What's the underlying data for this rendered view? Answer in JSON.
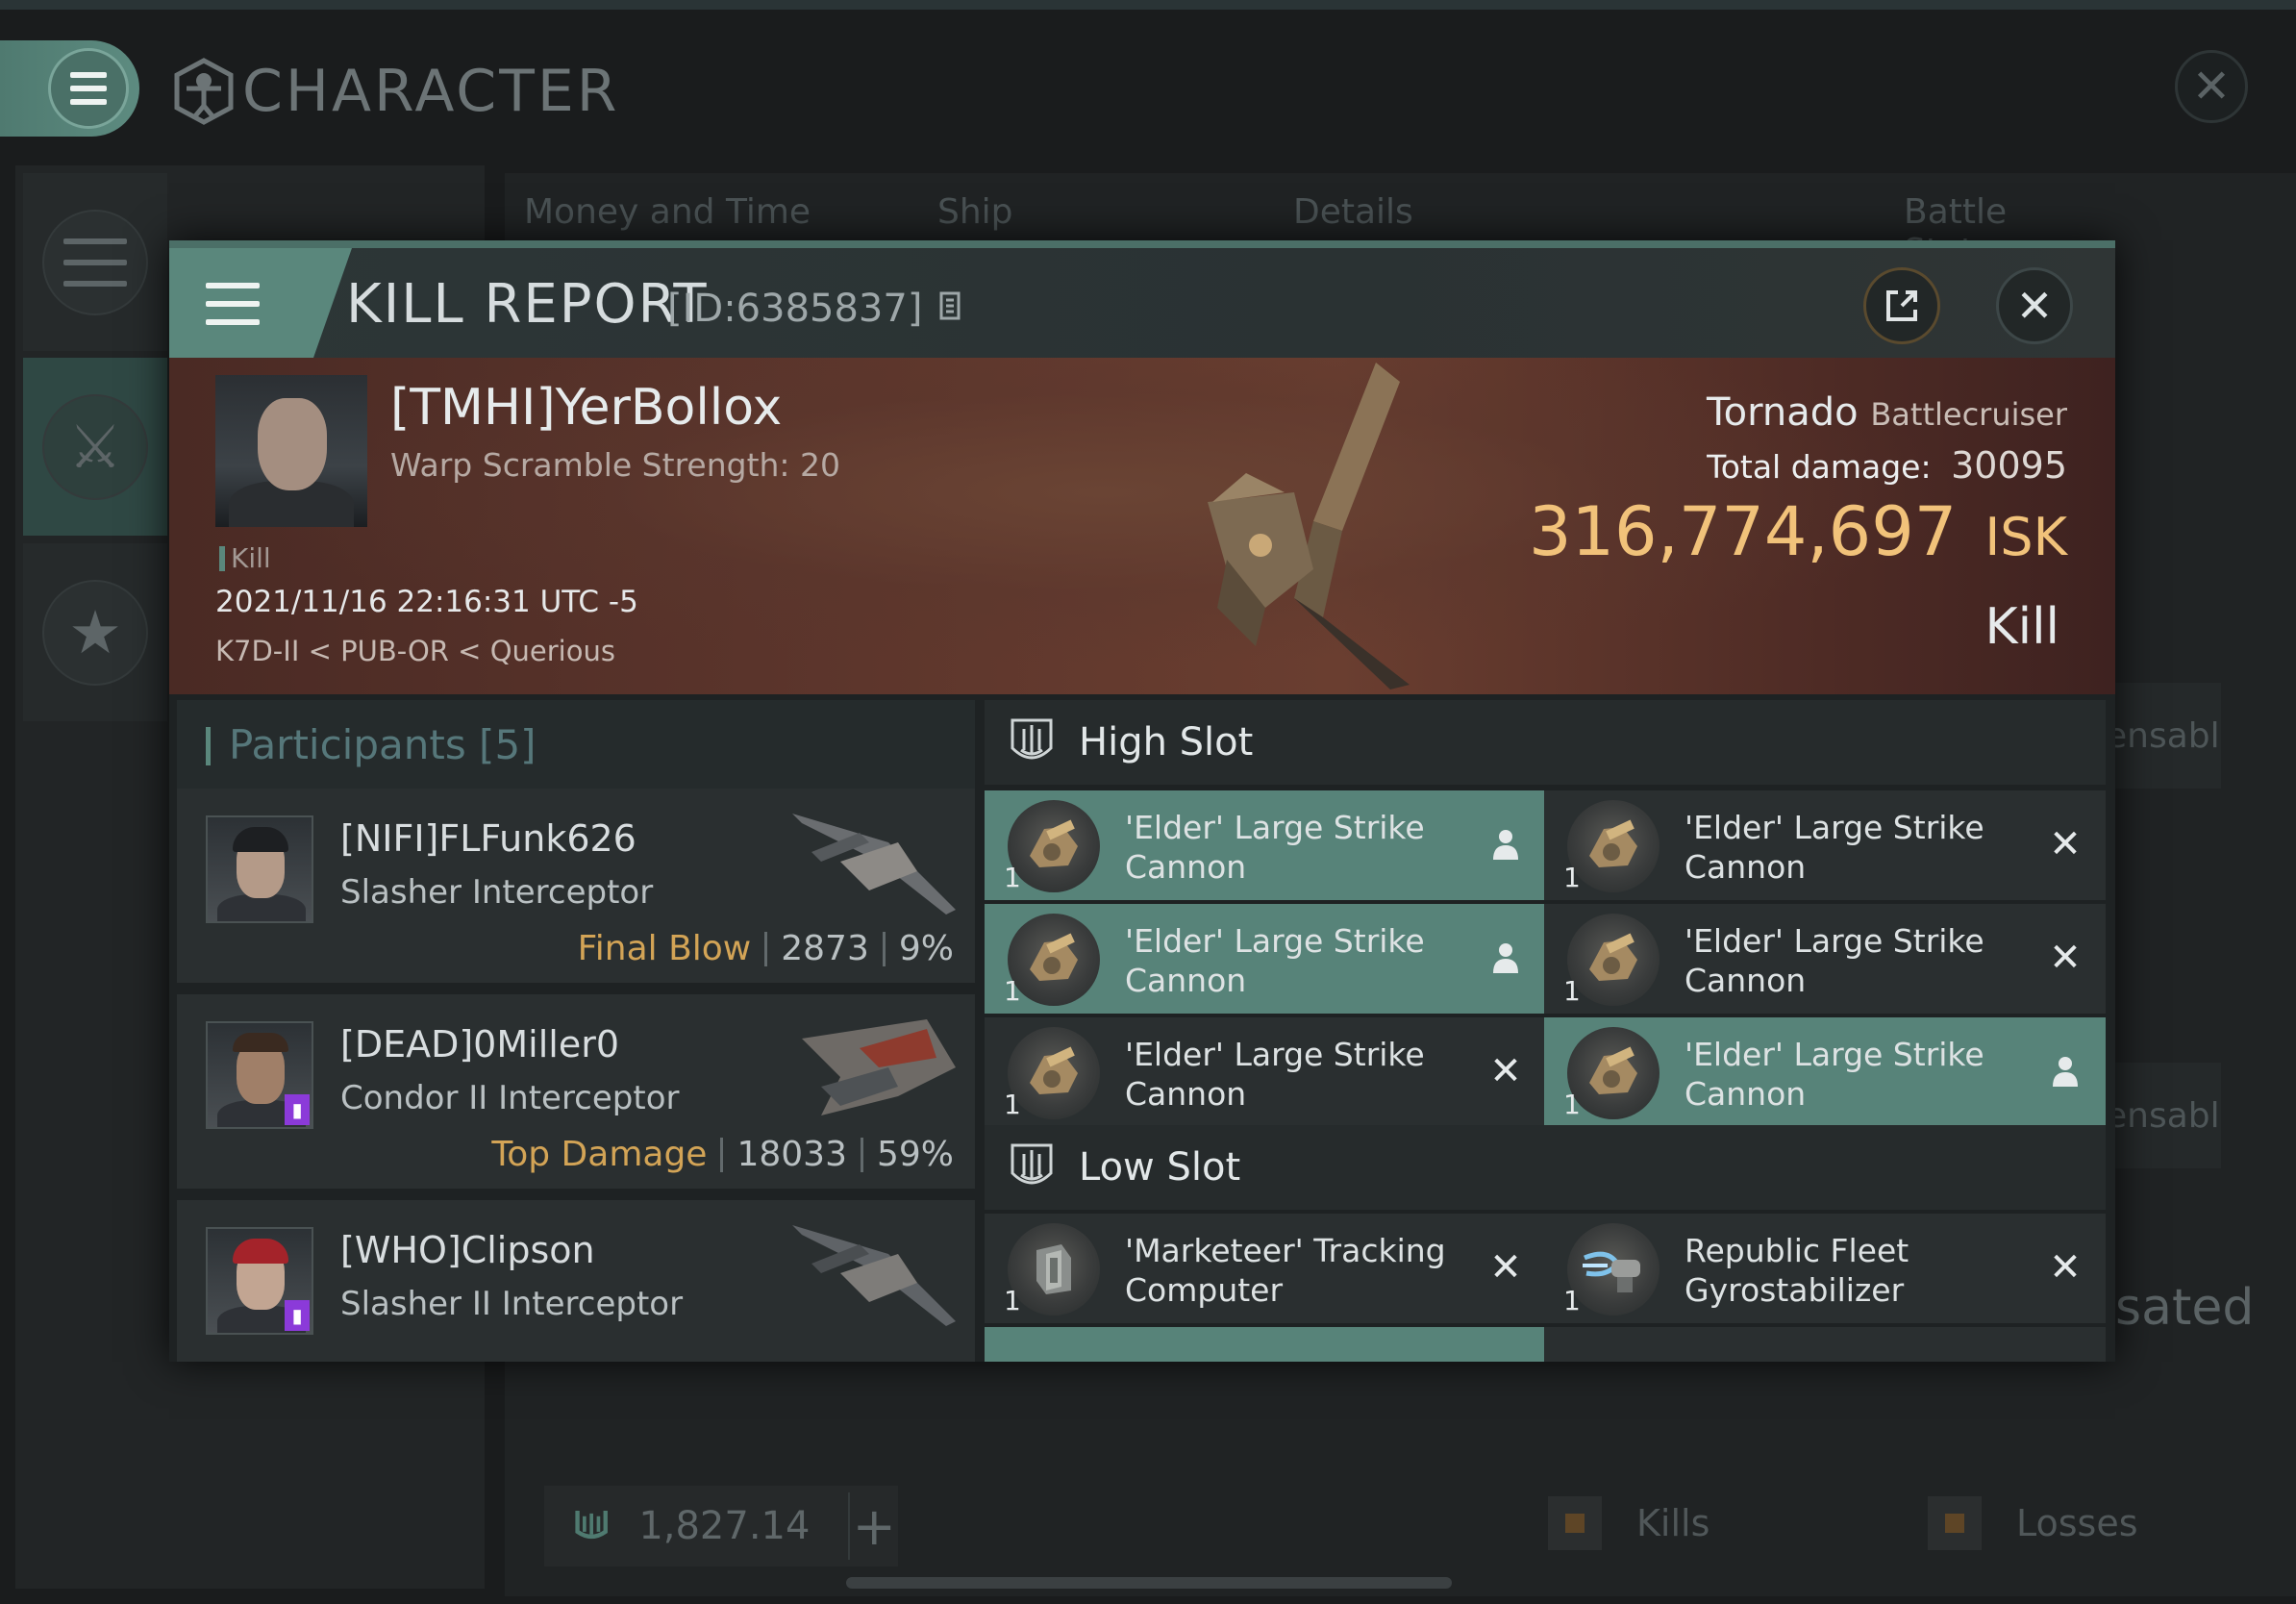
{
  "background_window": {
    "title": "CHARACTER",
    "tabs": [
      "Money and Time",
      "Ship",
      "Details",
      "Battle Status"
    ],
    "right_buttons": [
      "ensable",
      "ensable"
    ],
    "right_text": "sated",
    "wallet_amount": "1,827.14",
    "legend": [
      "Kills",
      "Losses"
    ]
  },
  "kill_report": {
    "title": "KILL REPORT",
    "id": "[ID:6385837]",
    "victim": {
      "name": "[TMHI]YerBollox",
      "warp_scramble": "Warp Scramble Strength: 20",
      "tag": "Kill",
      "datetime": "2021/11/16 22:16:31 UTC -5",
      "location": "K7D-II < PUB-OR < Querious"
    },
    "ship": {
      "name": "Tornado",
      "class": "Battlecruiser",
      "total_damage_label": "Total damage:",
      "total_damage": "30095",
      "isk_value": "316,774,697",
      "isk_unit": "ISK",
      "result": "Kill"
    },
    "participants": {
      "header": "Participants [5]",
      "rows": [
        {
          "name": "[NIFI]FLFunk626",
          "ship": "Slasher Interceptor",
          "label": "Final Blow",
          "damage": "2873",
          "percent": "9%"
        },
        {
          "name": "[DEAD]0Miller0",
          "ship": "Condor II Interceptor",
          "label": "Top Damage",
          "damage": "18033",
          "percent": "59%"
        },
        {
          "name": "[WHO]Clipson",
          "ship": "Slasher II Interceptor",
          "label": "",
          "damage": "",
          "percent": ""
        }
      ]
    },
    "high_slot": {
      "header": "High Slot",
      "modules": [
        {
          "name": "'Elder' Large Strike Cannon",
          "qty": "1",
          "status": "person-icon",
          "selected": true
        },
        {
          "name": "'Elder' Large Strike Cannon",
          "qty": "1",
          "status": "cross-icon",
          "selected": false
        },
        {
          "name": "'Elder' Large Strike Cannon",
          "qty": "1",
          "status": "person-icon",
          "selected": true
        },
        {
          "name": "'Elder' Large Strike Cannon",
          "qty": "1",
          "status": "cross-icon",
          "selected": false
        },
        {
          "name": "'Elder' Large Strike Cannon",
          "qty": "1",
          "status": "cross-icon",
          "selected": false
        },
        {
          "name": "'Elder' Large Strike Cannon",
          "qty": "1",
          "status": "person-icon",
          "selected": true
        }
      ]
    },
    "low_slot": {
      "header": "Low Slot",
      "modules": [
        {
          "name": "'Marketeer' Tracking Computer",
          "qty": "1",
          "status": "cross-icon",
          "selected": false
        },
        {
          "name": "Republic Fleet Gyrostabilizer",
          "qty": "1",
          "status": "cross-icon",
          "selected": false
        }
      ]
    },
    "colors": {
      "accent_teal": "#5a877c",
      "isk_gold": "#f1c27a",
      "label_gold": "#d3a456",
      "faction_purple": "#8b3ad9"
    }
  }
}
